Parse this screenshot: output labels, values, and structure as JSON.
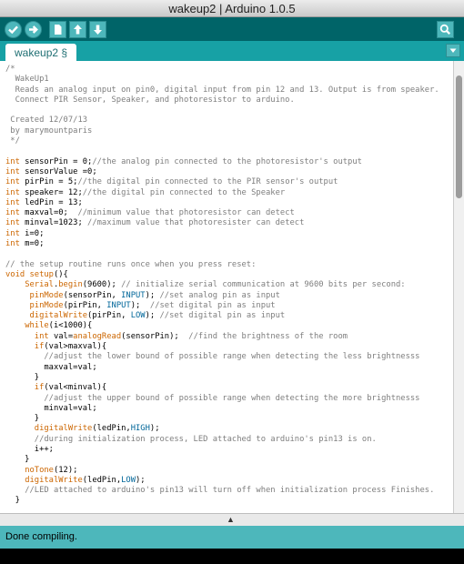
{
  "window": {
    "title": "wakeup2 | Arduino 1.0.5"
  },
  "toolbar": {
    "buttons": [
      {
        "name": "verify",
        "icon": "check-icon"
      },
      {
        "name": "upload",
        "icon": "arrow-right-icon"
      },
      {
        "name": "new",
        "icon": "new-file-icon"
      },
      {
        "name": "open",
        "icon": "arrow-up-icon"
      },
      {
        "name": "save",
        "icon": "arrow-down-icon"
      },
      {
        "name": "serial-monitor",
        "icon": "magnifier-icon"
      }
    ]
  },
  "tabs": {
    "active_label": "wakeup2 §",
    "menu_icon": "triangle-down-icon"
  },
  "code": {
    "lines": [
      [
        {
          "t": "/*",
          "c": "comment"
        }
      ],
      [
        {
          "t": "  WakeUp1",
          "c": "comment"
        }
      ],
      [
        {
          "t": "  Reads an analog input on pin0, digital input from pin 12 and 13. Output is from speaker.",
          "c": "comment"
        }
      ],
      [
        {
          "t": "  Connect PIR Sensor, Speaker, and photoresistor to arduino.",
          "c": "comment"
        }
      ],
      [
        {
          "t": "",
          "c": ""
        }
      ],
      [
        {
          "t": " Created 12/07/13",
          "c": "comment"
        }
      ],
      [
        {
          "t": " by marymountparis",
          "c": "comment"
        }
      ],
      [
        {
          "t": " */",
          "c": "comment"
        }
      ],
      [
        {
          "t": "",
          "c": ""
        }
      ],
      [
        {
          "t": "int",
          "c": "type"
        },
        {
          "t": " sensorPin = 0;",
          "c": ""
        },
        {
          "t": "//the analog pin connected to the photoresistor's output",
          "c": "comment"
        }
      ],
      [
        {
          "t": "int",
          "c": "type"
        },
        {
          "t": " sensorValue =0;",
          "c": ""
        }
      ],
      [
        {
          "t": "int",
          "c": "type"
        },
        {
          "t": " pirPin = 5;",
          "c": ""
        },
        {
          "t": "//the digital pin connected to the PIR sensor's output",
          "c": "comment"
        }
      ],
      [
        {
          "t": "int",
          "c": "type"
        },
        {
          "t": " speaker= 12;",
          "c": ""
        },
        {
          "t": "//the digital pin connected to the Speaker",
          "c": "comment"
        }
      ],
      [
        {
          "t": "int",
          "c": "type"
        },
        {
          "t": " ledPin = 13;",
          "c": ""
        }
      ],
      [
        {
          "t": "int",
          "c": "type"
        },
        {
          "t": " maxval=0;  ",
          "c": ""
        },
        {
          "t": "//minimum value that photoresistor can detect",
          "c": "comment"
        }
      ],
      [
        {
          "t": "int",
          "c": "type"
        },
        {
          "t": " minval=1023; ",
          "c": ""
        },
        {
          "t": "//maximum value that photoresister can detect",
          "c": "comment"
        }
      ],
      [
        {
          "t": "int",
          "c": "type"
        },
        {
          "t": " i=0;",
          "c": ""
        }
      ],
      [
        {
          "t": "int",
          "c": "type"
        },
        {
          "t": " m=0;",
          "c": ""
        }
      ],
      [
        {
          "t": "",
          "c": ""
        }
      ],
      [
        {
          "t": "// the setup routine runs once when you press reset:",
          "c": "comment"
        }
      ],
      [
        {
          "t": "void",
          "c": "type"
        },
        {
          "t": " ",
          "c": ""
        },
        {
          "t": "setup",
          "c": "kw"
        },
        {
          "t": "(){",
          "c": ""
        }
      ],
      [
        {
          "t": "    ",
          "c": ""
        },
        {
          "t": "Serial",
          "c": "func"
        },
        {
          "t": ".",
          "c": ""
        },
        {
          "t": "begin",
          "c": "func"
        },
        {
          "t": "(9600); ",
          "c": ""
        },
        {
          "t": "// initialize serial communication at 9600 bits per second:",
          "c": "comment"
        }
      ],
      [
        {
          "t": "     ",
          "c": ""
        },
        {
          "t": "pinMode",
          "c": "func"
        },
        {
          "t": "(sensorPin, ",
          "c": ""
        },
        {
          "t": "INPUT",
          "c": "const"
        },
        {
          "t": "); ",
          "c": ""
        },
        {
          "t": "//set analog pin as input",
          "c": "comment"
        }
      ],
      [
        {
          "t": "     ",
          "c": ""
        },
        {
          "t": "pinMode",
          "c": "func"
        },
        {
          "t": "(pirPin, ",
          "c": ""
        },
        {
          "t": "INPUT",
          "c": "const"
        },
        {
          "t": ");  ",
          "c": ""
        },
        {
          "t": "//set digital pin as input",
          "c": "comment"
        }
      ],
      [
        {
          "t": "     ",
          "c": ""
        },
        {
          "t": "digitalWrite",
          "c": "func"
        },
        {
          "t": "(pirPin, ",
          "c": ""
        },
        {
          "t": "LOW",
          "c": "const"
        },
        {
          "t": "); ",
          "c": ""
        },
        {
          "t": "//set digital pin as input",
          "c": "comment"
        }
      ],
      [
        {
          "t": "    ",
          "c": ""
        },
        {
          "t": "while",
          "c": "kw"
        },
        {
          "t": "(i<1000){",
          "c": ""
        }
      ],
      [
        {
          "t": "      ",
          "c": ""
        },
        {
          "t": "int",
          "c": "type"
        },
        {
          "t": " val=",
          "c": ""
        },
        {
          "t": "analogRead",
          "c": "func"
        },
        {
          "t": "(sensorPin);  ",
          "c": ""
        },
        {
          "t": "//find the brightness of the room",
          "c": "comment"
        }
      ],
      [
        {
          "t": "      ",
          "c": ""
        },
        {
          "t": "if",
          "c": "kw"
        },
        {
          "t": "(val>maxval){",
          "c": ""
        }
      ],
      [
        {
          "t": "        ",
          "c": ""
        },
        {
          "t": "//adjust the lower bound of possible range when detecting the less brightnesss",
          "c": "comment"
        }
      ],
      [
        {
          "t": "        maxval=val;",
          "c": ""
        }
      ],
      [
        {
          "t": "      }",
          "c": ""
        }
      ],
      [
        {
          "t": "      ",
          "c": ""
        },
        {
          "t": "if",
          "c": "kw"
        },
        {
          "t": "(val<minval){",
          "c": ""
        }
      ],
      [
        {
          "t": "        ",
          "c": ""
        },
        {
          "t": "//adjust the upper bound of possible range when detecting the more brightnesss",
          "c": "comment"
        }
      ],
      [
        {
          "t": "        minval=val;",
          "c": ""
        }
      ],
      [
        {
          "t": "      }",
          "c": ""
        }
      ],
      [
        {
          "t": "      ",
          "c": ""
        },
        {
          "t": "digitalWrite",
          "c": "func"
        },
        {
          "t": "(ledPin,",
          "c": ""
        },
        {
          "t": "HIGH",
          "c": "const"
        },
        {
          "t": ");",
          "c": ""
        }
      ],
      [
        {
          "t": "      ",
          "c": ""
        },
        {
          "t": "//during initialization process, LED attached to arduino's pin13 is on.",
          "c": "comment"
        }
      ],
      [
        {
          "t": "      i++;",
          "c": ""
        }
      ],
      [
        {
          "t": "    }",
          "c": ""
        }
      ],
      [
        {
          "t": "    ",
          "c": ""
        },
        {
          "t": "noTone",
          "c": "func"
        },
        {
          "t": "(12);",
          "c": ""
        }
      ],
      [
        {
          "t": "    ",
          "c": ""
        },
        {
          "t": "digitalWrite",
          "c": "func"
        },
        {
          "t": "(ledPin,",
          "c": ""
        },
        {
          "t": "LOW",
          "c": "const"
        },
        {
          "t": ");",
          "c": ""
        }
      ],
      [
        {
          "t": "    ",
          "c": ""
        },
        {
          "t": "//LED attached to arduino's pin13 will turn off when initialization process Finishes.",
          "c": "comment"
        }
      ],
      [
        {
          "t": "  }",
          "c": ""
        }
      ]
    ]
  },
  "status": {
    "message": "Done compiling."
  },
  "colors": {
    "teal_dark": "#006468",
    "teal_light": "#4db7bb",
    "comment": "#7e7e7e",
    "keyword": "#cc6600",
    "constant": "#006699"
  }
}
